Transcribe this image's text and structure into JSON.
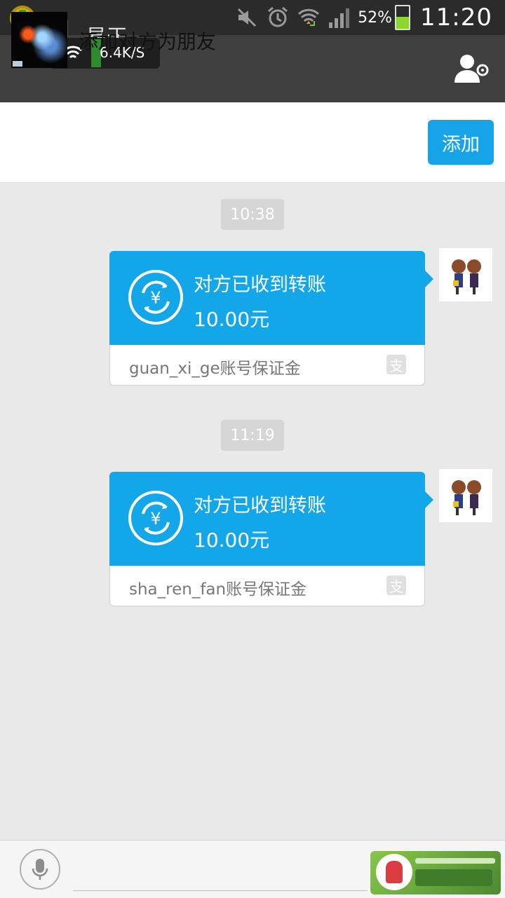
{
  "status_bar": {
    "battery_percent": "52%",
    "time": "11:20",
    "network_speed": "6.4K/S"
  },
  "nav": {
    "title": "易天"
  },
  "banner": {
    "text": "添加对方为朋友",
    "add_label": "添加"
  },
  "messages": [
    {
      "time": "10:38",
      "title": "对方已收到转账",
      "amount": "10.00元",
      "note": "guan_xi_ge账号保证金",
      "source_icon": "支"
    },
    {
      "time": "11:19",
      "title": "对方已收到转账",
      "amount": "10.00元",
      "note": "sha_ren_fan账号保证金",
      "source_icon": "支"
    }
  ],
  "colors": {
    "accent": "#13a7ea",
    "navbar": "#3f3f3f",
    "background": "#e9e9e9"
  }
}
